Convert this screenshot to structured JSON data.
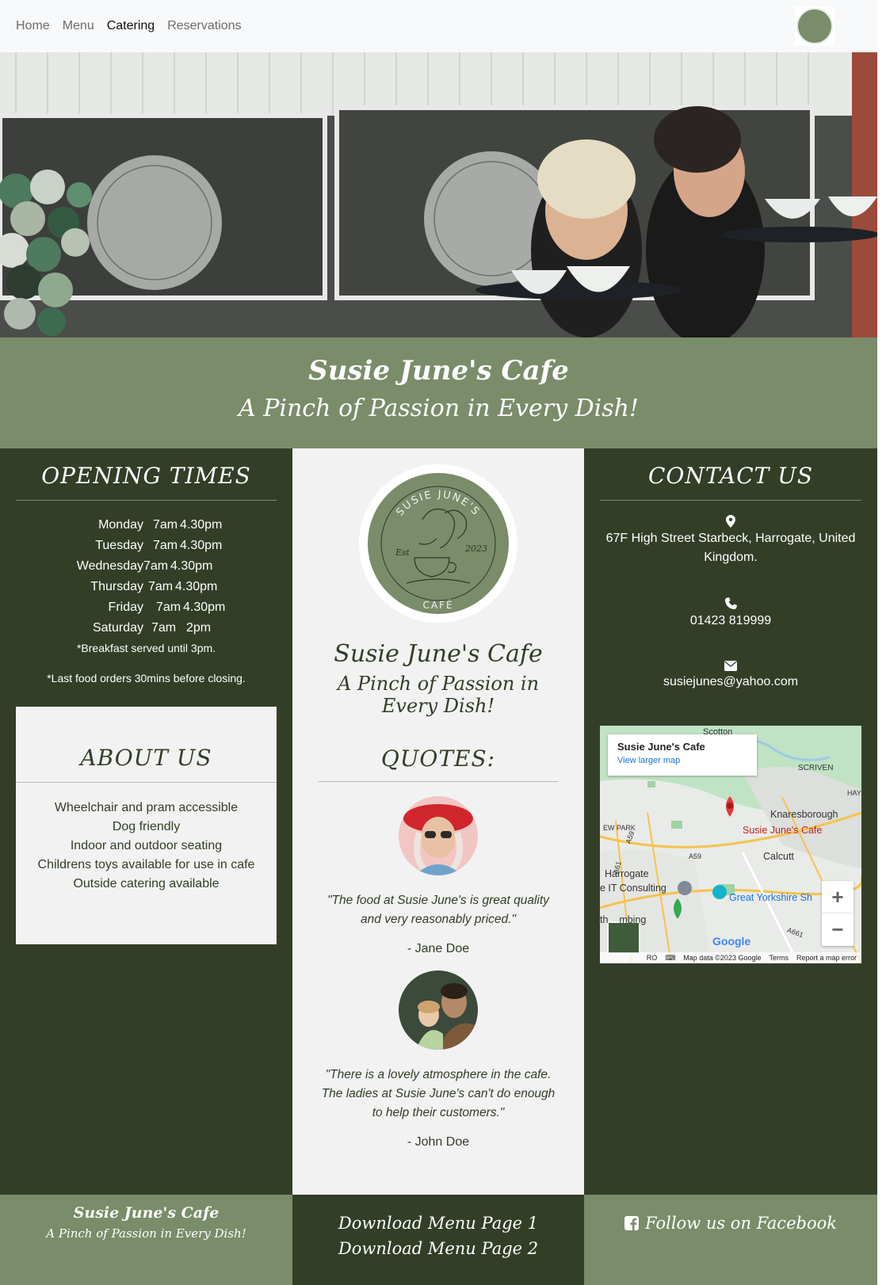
{
  "nav": {
    "items": [
      {
        "label": "Home"
      },
      {
        "label": "Menu"
      },
      {
        "label": "Catering"
      },
      {
        "label": "Reservations"
      }
    ]
  },
  "brand": {
    "name": "Susie June's Cafe",
    "tagline": "A Pinch of Passion in Every Dish!",
    "logo_text_top": "SUSIE JUNE'S",
    "logo_text_bottom": "CAFÉ",
    "logo_est": "Est",
    "logo_year": "2023"
  },
  "colors": {
    "sage": "#7a8c6a",
    "dark_green": "#333e27",
    "light_gray": "#f2f2f2"
  },
  "opening": {
    "heading": "OPENING TIMES",
    "rows": [
      {
        "day": "Monday",
        "open": "7am",
        "close": "4.30pm"
      },
      {
        "day": "Tuesday",
        "open": "7am",
        "close": "4.30pm"
      },
      {
        "day": "Wednesday",
        "open": "7am",
        "close": "4.30pm"
      },
      {
        "day": "Thursday",
        "open": "7am",
        "close": "4.30pm"
      },
      {
        "day": "Friday",
        "open": "7am",
        "close": "4.30pm"
      },
      {
        "day": "Saturday",
        "open": "7am",
        "close": "2pm"
      }
    ],
    "note1": "*Breakfast served until 3pm.",
    "note2": "*Last food orders 30mins before closing."
  },
  "about": {
    "heading": "ABOUT US",
    "items": [
      "Wheelchair and pram accessible",
      "Dog friendly",
      "Indoor and outdoor seating",
      "Childrens toys available for use in cafe",
      "Outside catering available"
    ]
  },
  "quotes": {
    "heading": "QUOTES:",
    "items": [
      {
        "text": "\"The food at Susie June's is great quality and very reasonably priced.\"",
        "author": "- Jane Doe"
      },
      {
        "text": "\"There is a lovely atmosphere in the cafe. The ladies at Susie June's can't do enough to help their customers.\"",
        "author": "- John Doe"
      }
    ]
  },
  "contact": {
    "heading": "CONTACT US",
    "address": "67F High Street Starbeck, Harrogate, United Kingdom.",
    "phone": "01423 819999",
    "email": "susiejunes@yahoo.com",
    "icons": {
      "address": "map-pin-icon",
      "phone": "phone-icon",
      "email": "envelope-icon"
    }
  },
  "map": {
    "card_title": "Susie June's Cafe",
    "card_link": "View larger map",
    "labels": {
      "scotton": "Scotton",
      "scriven": "SCRIVEN",
      "knaresborough": "Knaresborough",
      "cafe": "Susie June's Cafe",
      "calcutt": "Calcutt",
      "harrogate": "Harrogate",
      "it": "e IT Consulting",
      "gys": "Great Yorkshire Sh",
      "climbing": "th    mbing",
      "park": "EW PARK",
      "a59": "A59",
      "a59b": "A59",
      "a61": "A61",
      "a661": "A661",
      "hay": "HAY"
    },
    "zoom_in": "+",
    "zoom_out": "−",
    "google": "Google",
    "footer": {
      "ro": "RO",
      "data": "Map data ©2023 Google",
      "terms": "Terms",
      "report": "Report a map error"
    }
  },
  "footer": {
    "name": "Susie June's Cafe",
    "tagline": "A Pinch of Passion in Every Dish!",
    "menu1": "Download Menu Page 1",
    "menu2": "Download Menu Page 2",
    "facebook": "Follow us on Facebook"
  }
}
